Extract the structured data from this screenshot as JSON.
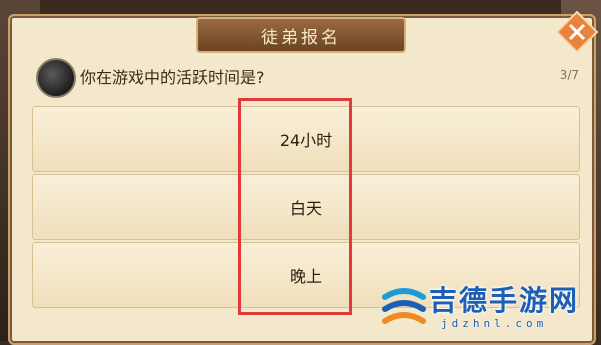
{
  "dialog": {
    "title": "徒弟报名",
    "question": "你在游戏中的活跃时间是?",
    "progress": "3/7"
  },
  "options": [
    {
      "label": "24小时"
    },
    {
      "label": "白天"
    },
    {
      "label": "晚上"
    }
  ],
  "icons": {
    "close": "close-icon",
    "avatar": "master-avatar-icon",
    "watermark": "jidezhijia-logo-icon"
  },
  "watermark": {
    "text": "吉德手游网",
    "url": "jdzhnl.com"
  },
  "colors": {
    "panel": "#f4e8cc",
    "title_bar": "#7b4e2a",
    "highlight": "#e23a3a",
    "close_accent": "#e8823c",
    "watermark": "#1d5fb5"
  }
}
